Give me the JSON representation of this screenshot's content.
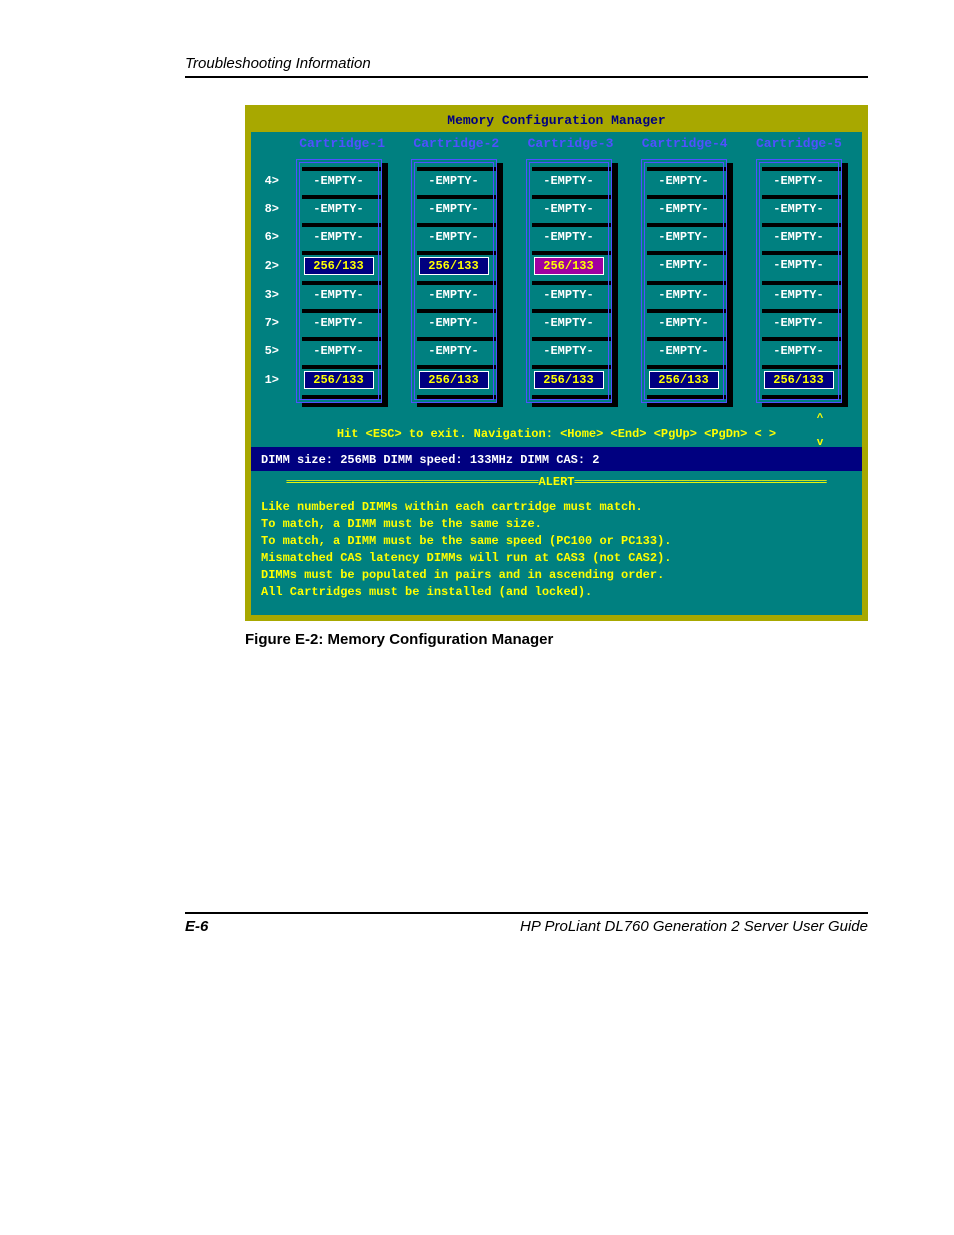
{
  "page": {
    "header": "Troubleshooting Information",
    "footer_left": "E-6",
    "footer_right": "HP ProLiant DL760 Generation 2 Server User Guide"
  },
  "figure": {
    "caption": "Figure E-2:  Memory Configuration Manager"
  },
  "bios": {
    "title": "Memory Configuration Manager",
    "cartridges": [
      "Cartridge-1",
      "Cartridge-2",
      "Cartridge-3",
      "Cartridge-4",
      "Cartridge-5"
    ],
    "row_labels": [
      "4>",
      "8>",
      "6>",
      "2>",
      "3>",
      "7>",
      "5>",
      "1>"
    ],
    "empty_text": "-EMPTY-",
    "grid": [
      [
        "-EMPTY-",
        "-EMPTY-",
        "-EMPTY-",
        "-EMPTY-",
        "-EMPTY-"
      ],
      [
        "-EMPTY-",
        "-EMPTY-",
        "-EMPTY-",
        "-EMPTY-",
        "-EMPTY-"
      ],
      [
        "-EMPTY-",
        "-EMPTY-",
        "-EMPTY-",
        "-EMPTY-",
        "-EMPTY-"
      ],
      [
        "256/133",
        "256/133",
        "256/133",
        "-EMPTY-",
        "-EMPTY-"
      ],
      [
        "-EMPTY-",
        "-EMPTY-",
        "-EMPTY-",
        "-EMPTY-",
        "-EMPTY-"
      ],
      [
        "-EMPTY-",
        "-EMPTY-",
        "-EMPTY-",
        "-EMPTY-",
        "-EMPTY-"
      ],
      [
        "-EMPTY-",
        "-EMPTY-",
        "-EMPTY-",
        "-EMPTY-",
        "-EMPTY-"
      ],
      [
        "256/133",
        "256/133",
        "256/133",
        "256/133",
        "256/133"
      ]
    ],
    "selected": {
      "row": 3,
      "col": 2
    },
    "nav_help": "Hit <ESC> to exit. Navigation: <Home> <End> <PgUp> <PgDn> <   >",
    "dimm_info": "DIMM size:  256MB  DIMM speed:  133MHz  DIMM CAS: 2",
    "alert_label": "ALERT",
    "alert_lines": [
      "Like numbered DIMMs within each cartridge must match.",
      "To match, a DIMM must be the same size.",
      "To match, a DIMM must be the same speed (PC100 or PC133).",
      "Mismatched CAS latency DIMMs will run at CAS3 (not CAS2).",
      "DIMMs must be populated in pairs and in ascending order.",
      "All Cartridges must be installed (and locked)."
    ]
  }
}
